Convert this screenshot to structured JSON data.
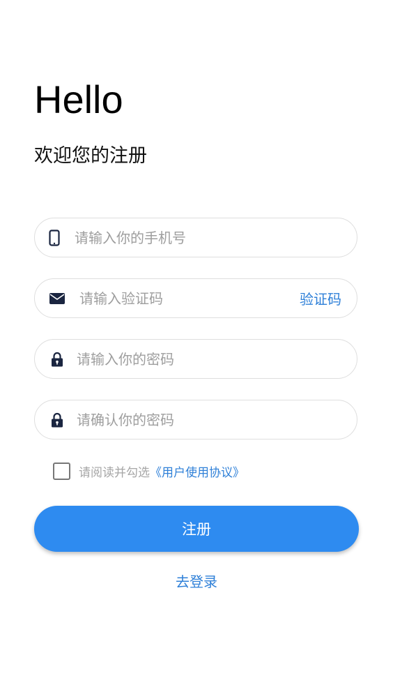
{
  "header": {
    "greeting": "Hello",
    "subtitle": "欢迎您的注册"
  },
  "form": {
    "phone": {
      "placeholder": "请输入你的手机号",
      "value": "",
      "icon": "mobile-phone-icon"
    },
    "code": {
      "placeholder": "请输入验证码",
      "value": "",
      "icon": "envelope-icon",
      "button_label": "验证码"
    },
    "password": {
      "placeholder": "请输入你的密码",
      "value": "",
      "icon": "lock-icon"
    },
    "confirm_password": {
      "placeholder": "请确认你的密码",
      "value": "",
      "icon": "lock-icon"
    }
  },
  "agreement": {
    "checked": false,
    "text": "请阅读并勾选",
    "link_label": "《用户使用协议》"
  },
  "actions": {
    "register_label": "注册",
    "login_label": "去登录"
  },
  "colors": {
    "primary": "#2e8bf0",
    "link": "#2f80d8",
    "icon": "#1a2540",
    "border": "#dedede",
    "placeholder": "#9e9e9e"
  }
}
